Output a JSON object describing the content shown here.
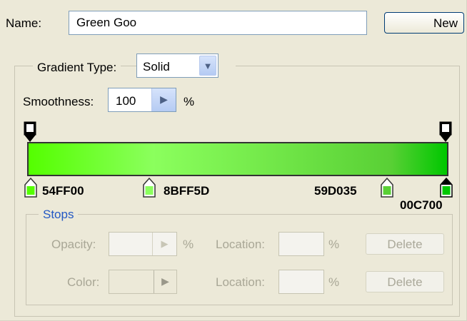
{
  "name": {
    "label": "Name:",
    "value": "Green Goo"
  },
  "new_button": {
    "label": "New"
  },
  "gradient_type": {
    "label": "Gradient Type:",
    "value": "Solid"
  },
  "smoothness": {
    "label": "Smoothness:",
    "value": "100",
    "unit": "%"
  },
  "gradient": {
    "color_stops": [
      {
        "hex": "54FF00",
        "color": "#54ff00",
        "location_pct": 0
      },
      {
        "hex": "8BFF5D",
        "color": "#8bff5d",
        "location_pct": 29.8
      },
      {
        "hex": "59D035",
        "color": "#59d035",
        "location_pct": 86.6
      },
      {
        "hex": "00C700",
        "color": "#00c700",
        "location_pct": 100
      }
    ],
    "opacity_stops": [
      {
        "location_pct": 0
      },
      {
        "location_pct": 100
      }
    ]
  },
  "stops": {
    "legend": "Stops",
    "opacity_label": "Opacity:",
    "opacity_value": "",
    "opacity_unit": "%",
    "opacity_location_label": "Location:",
    "opacity_location_unit": "%",
    "opacity_delete": "Delete",
    "color_label": "Color:",
    "color_location_label": "Location:",
    "color_location_unit": "%",
    "color_delete": "Delete"
  }
}
